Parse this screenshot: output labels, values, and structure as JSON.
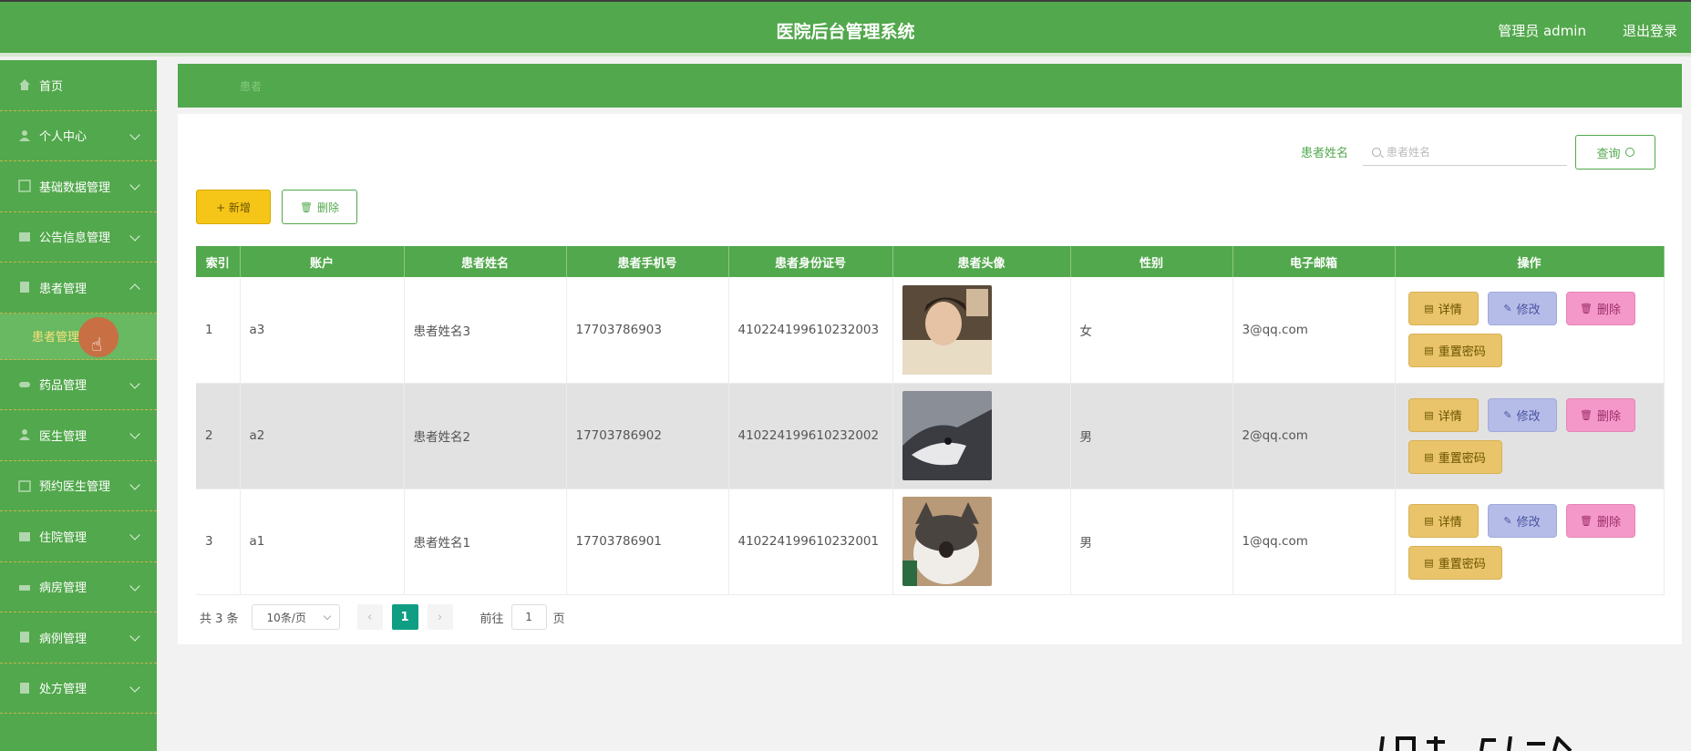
{
  "header": {
    "title": "医院后台管理系统",
    "admin": "管理员 admin",
    "logout": "退出登录"
  },
  "sidebar": {
    "items": [
      {
        "label": "首页",
        "icon": "home-icon"
      },
      {
        "label": "个人中心",
        "icon": "user-icon"
      },
      {
        "label": "基础数据管理",
        "icon": "data-icon"
      },
      {
        "label": "公告信息管理",
        "icon": "notice-icon"
      },
      {
        "label": "患者管理",
        "icon": "patient-icon",
        "expanded": true
      },
      {
        "label": "药品管理",
        "icon": "medicine-icon"
      },
      {
        "label": "医生管理",
        "icon": "doctor-icon"
      },
      {
        "label": "预约医生管理",
        "icon": "appointment-icon"
      },
      {
        "label": "住院管理",
        "icon": "hospital-icon"
      },
      {
        "label": "病房管理",
        "icon": "ward-icon"
      },
      {
        "label": "病例管理",
        "icon": "case-icon"
      },
      {
        "label": "处方管理",
        "icon": "prescription-icon"
      }
    ],
    "active_sub": "患者管理"
  },
  "breadcrumb": {
    "text": "患者"
  },
  "search": {
    "label": "患者姓名",
    "placeholder": "患者姓名",
    "button": "查询"
  },
  "toolbar": {
    "add": "+ 新增",
    "delete": "删除"
  },
  "table": {
    "headers": [
      "索引",
      "账户",
      "患者姓名",
      "患者手机号",
      "患者身份证号",
      "患者头像",
      "性别",
      "电子邮箱",
      "操作"
    ],
    "rows": [
      {
        "index": "1",
        "account": "a3",
        "name": "患者姓名3",
        "phone": "17703786903",
        "id_card": "410224199610232003",
        "avatar": "photo-boy",
        "gender": "女",
        "email": "3@qq.com"
      },
      {
        "index": "2",
        "account": "a2",
        "name": "患者姓名2",
        "phone": "17703786902",
        "id_card": "410224199610232002",
        "avatar": "photo-husky",
        "gender": "男",
        "email": "2@qq.com"
      },
      {
        "index": "3",
        "account": "a1",
        "name": "患者姓名1",
        "phone": "17703786901",
        "id_card": "410224199610232001",
        "avatar": "photo-cat",
        "gender": "男",
        "email": "1@qq.com"
      }
    ],
    "actions": {
      "detail": "详情",
      "edit": "修改",
      "delete": "删除",
      "reset": "重置密码"
    }
  },
  "pagination": {
    "total": "共 3 条",
    "page_size": "10条/页",
    "current": "1",
    "goto_label": "前往",
    "goto_value": "1",
    "unit": "页"
  },
  "colors": {
    "primary": "#52a84c",
    "accent_yellow": "#f5c518",
    "page_active": "#0f9e83"
  }
}
